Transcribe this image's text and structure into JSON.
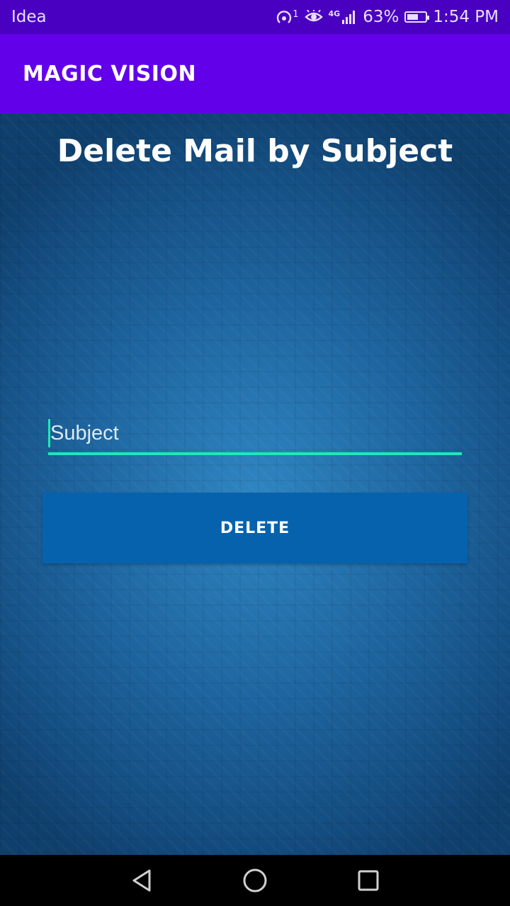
{
  "status_bar": {
    "carrier": "Idea",
    "hotspot_count": "1",
    "network_type": "4G",
    "battery_percent": "63%",
    "battery_level": 0.63,
    "time": "1:54 PM",
    "icons": [
      "hotspot-icon",
      "eye-comfort-icon",
      "signal-icon",
      "battery-icon"
    ]
  },
  "app_bar": {
    "title": "MAGIC VISION",
    "color": "#6200ea"
  },
  "main": {
    "heading": "Delete Mail by Subject",
    "subject_input": {
      "placeholder": "Subject",
      "value": ""
    },
    "delete_button": {
      "label": "DELETE"
    },
    "accent_color": "#1de9b6"
  },
  "nav_bar": {
    "buttons": [
      "back-icon",
      "home-icon",
      "recents-icon"
    ]
  }
}
